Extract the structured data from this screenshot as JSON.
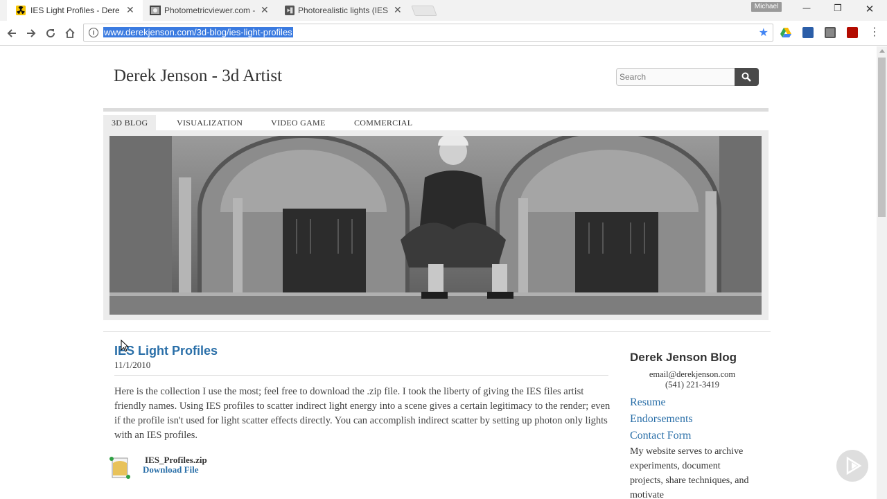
{
  "browser": {
    "tabs": [
      {
        "title": "IES Light Profiles - Derek",
        "active": true
      },
      {
        "title": "Photometricviewer.com -",
        "active": false
      },
      {
        "title": "Photorealistic lights (IES)",
        "active": false
      }
    ],
    "profile_name": "Michael",
    "url": "www.derekjenson.com/3d-blog/ies-light-profiles",
    "window_controls": {
      "minimize": "—",
      "restore": "❐",
      "close": "✕"
    }
  },
  "site": {
    "title": "Derek Jenson - 3d Artist",
    "search_placeholder": "Search",
    "nav": [
      "3D BLOG",
      "VISUALIZATION",
      "VIDEO GAME",
      "COMMERCIAL"
    ]
  },
  "post": {
    "title": "IES Light Profiles",
    "date": "11/1/2010",
    "body": "Here is the collection I use the most; feel free to download the .zip file. I took the liberty of giving the IES files artist friendly names. Using IES profiles to scatter indirect light energy into a scene gives a certain legitimacy to the render; even if the profile isn't used for light scatter effects directly. You can accomplish indirect scatter by setting up photon only lights with an IES profiles.",
    "attachment": {
      "filename": "IES_Profiles.zip",
      "link_label": "Download File"
    }
  },
  "sidebar": {
    "title": "Derek Jenson Blog",
    "email": "email@derekjenson.com",
    "phone": "(541) 221-3419",
    "links": [
      "Resume",
      "Endorsements",
      "Contact Form"
    ],
    "text": "My website serves  to archive experiments, document projects, share techniques, and motivate"
  },
  "colors": {
    "link": "#2a6fa8",
    "accent_star": "#4285f4"
  }
}
